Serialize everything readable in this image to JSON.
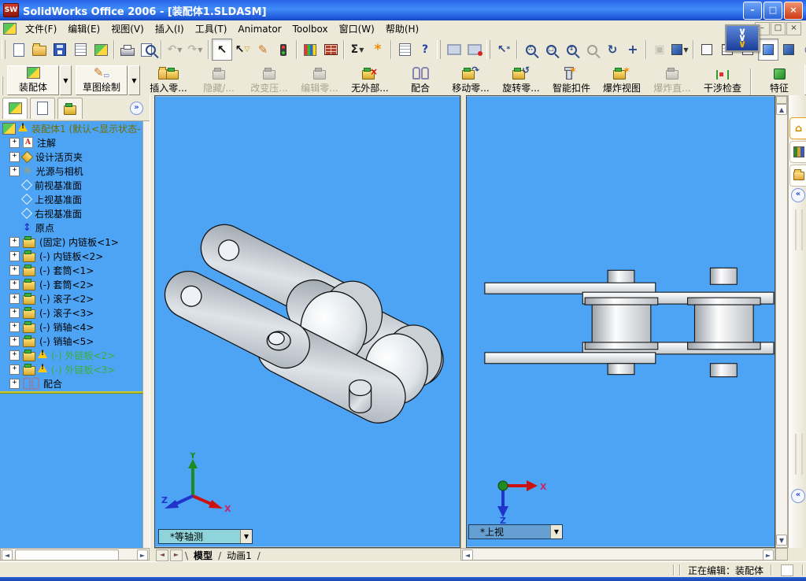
{
  "window": {
    "title": "SolidWorks Office 2006 - [装配体1.SLDASM]",
    "controls": {
      "minimize": "–",
      "restore": "□",
      "close": "×"
    }
  },
  "menu": {
    "items": [
      "文件(F)",
      "编辑(E)",
      "视图(V)",
      "插入(I)",
      "工具(T)",
      "Animator",
      "Toolbox",
      "窗口(W)",
      "帮助(H)"
    ],
    "mdi_controls": {
      "minimize": "–",
      "restore": "□",
      "close": "×"
    }
  },
  "toolbar_standard": {
    "left": [
      {
        "grip": true
      },
      {
        "n": "new-document"
      },
      {
        "n": "open"
      },
      {
        "n": "save"
      },
      {
        "n": "make-drawing"
      },
      {
        "n": "make-assembly"
      },
      {
        "sep": true
      },
      {
        "n": "print"
      },
      {
        "n": "print-preview"
      },
      {
        "sep": true
      },
      {
        "n": "undo",
        "dis": true,
        "dd": true
      },
      {
        "n": "redo",
        "dis": true,
        "dd": true
      },
      {
        "sep": true
      },
      {
        "n": "select",
        "act": true
      },
      {
        "n": "select-filter"
      },
      {
        "n": "sketch"
      },
      {
        "n": "traffic-light"
      },
      {
        "sep": true
      },
      {
        "n": "edit-color"
      },
      {
        "n": "texture"
      },
      {
        "sep": true
      },
      {
        "n": "measure",
        "dd": true
      },
      {
        "n": "feature-statistics"
      },
      {
        "sep": true
      },
      {
        "n": "properties-list"
      }
    ],
    "right": [
      {
        "n": "help"
      },
      {
        "grip": true
      },
      {
        "n": "fullscreen"
      },
      {
        "n": "viewport-display"
      },
      {
        "grip": true
      },
      {
        "n": "fly-select"
      },
      {
        "sep": true
      },
      {
        "n": "zoom-fit"
      },
      {
        "n": "zoom-area"
      },
      {
        "n": "zoom-in-out"
      },
      {
        "n": "zoom-selection",
        "dis": true
      },
      {
        "n": "rotate-view"
      },
      {
        "n": "pan"
      },
      {
        "sep": true
      },
      {
        "n": "render",
        "dis": true
      },
      {
        "n": "standard-views",
        "dd": true
      },
      {
        "sep": true
      },
      {
        "n": "wireframe"
      },
      {
        "n": "hidden-lines-visible"
      },
      {
        "n": "hidden-lines-removed"
      },
      {
        "n": "shaded",
        "act": true
      },
      {
        "n": "shadows"
      },
      {
        "n": "section-view"
      }
    ],
    "overflow_chevron": "»"
  },
  "toolbar_assembly": {
    "buttons": [
      {
        "label": "装配体",
        "icon": "assembly",
        "dropdown": true,
        "raised": true
      },
      {
        "label": "草图绘制",
        "icon": "sketch-pencil",
        "dropdown": true,
        "raised": true
      },
      {
        "label": "插入零...",
        "icon": "insert-component"
      },
      {
        "label": "隐藏/...",
        "icon": "part-gray",
        "disabled": true
      },
      {
        "label": "改变压...",
        "icon": "part-gray",
        "disabled": true
      },
      {
        "label": "编辑零...",
        "icon": "part-gray",
        "disabled": true
      },
      {
        "label": "无外部...",
        "icon": "no-external"
      },
      {
        "label": "配合",
        "icon": "mate"
      },
      {
        "label": "移动零...",
        "icon": "move-component"
      },
      {
        "label": "旋转零...",
        "icon": "rotate-component"
      },
      {
        "label": "智能扣件",
        "icon": "smart-fasteners"
      },
      {
        "label": "爆炸视图",
        "icon": "exploded-view"
      },
      {
        "label": "爆炸直...",
        "icon": "explode-line",
        "disabled": true
      },
      {
        "label": "干涉检查",
        "icon": "interference"
      },
      {
        "label": "特征",
        "icon": "features",
        "dropdown": true,
        "sep_before": true
      }
    ],
    "overflow_chevron": "»"
  },
  "feature_tree": {
    "tabs": [
      "featuremanager",
      "propertymanager",
      "configurationmanager"
    ],
    "collapse_chevron": "»",
    "root": {
      "label": "装配体1 (默认<显示状态-",
      "icon": "assembly",
      "warning": true
    },
    "items": [
      {
        "icon": "annotations",
        "label": "注解",
        "expand": true
      },
      {
        "icon": "design-binder",
        "label": "设计活页夹",
        "expand": true
      },
      {
        "icon": "lights-cameras",
        "label": "光源与相机",
        "expand": true
      },
      {
        "icon": "plane",
        "label": "前视基准面"
      },
      {
        "icon": "plane",
        "label": "上视基准面"
      },
      {
        "icon": "plane",
        "label": "右视基准面"
      },
      {
        "icon": "origin",
        "label": "原点"
      },
      {
        "icon": "part",
        "label": "(固定) 内链板<1>",
        "expand": true
      },
      {
        "icon": "part",
        "label": "(-) 内链板<2>",
        "expand": true
      },
      {
        "icon": "part",
        "label": "(-) 套筒<1>",
        "expand": true
      },
      {
        "icon": "part",
        "label": "(-) 套筒<2>",
        "expand": true
      },
      {
        "icon": "part",
        "label": "(-) 滚子<2>",
        "expand": true
      },
      {
        "icon": "part",
        "label": "(-) 滚子<3>",
        "expand": true
      },
      {
        "icon": "part",
        "label": "(-) 销轴<4>",
        "expand": true
      },
      {
        "icon": "part",
        "label": "(-) 销轴<5>",
        "expand": true
      },
      {
        "icon": "part",
        "label": "(-) 外链板<2>",
        "expand": true,
        "warning": true,
        "green": true
      },
      {
        "icon": "part",
        "label": "(-) 外链板<3>",
        "expand": true,
        "warning": true,
        "green": true
      },
      {
        "icon": "mates",
        "label": "配合",
        "expand": true
      }
    ]
  },
  "viewport_left": {
    "view_label": "*等轴测",
    "triad": {
      "x": "X",
      "y": "Y",
      "z": "Z"
    }
  },
  "viewport_right": {
    "view_label": "*上视",
    "triad": {
      "x": "X",
      "z": "Z"
    }
  },
  "doc_tabs": {
    "tabs": [
      {
        "label": "模型",
        "active": true
      },
      {
        "label": "动画1",
        "active": false
      }
    ]
  },
  "status_bar": {
    "text": "正在编辑：装配体"
  },
  "colors": {
    "viewport_bg": "#4da4f4",
    "titlebar_blue": "#2a64e8",
    "chrome_tan": "#ece9d8",
    "warning_yellow": "#ffc800",
    "suppressed_green": "#3fae37",
    "rollback_yellow": "#c8c832"
  }
}
